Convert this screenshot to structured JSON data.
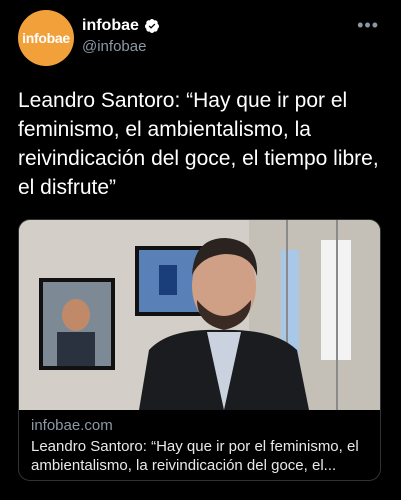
{
  "account": {
    "avatar_text": "infobae",
    "display_name": "infobae",
    "handle": "@infobae",
    "more_label": "•••"
  },
  "tweet": {
    "text": "Leandro Santoro: “Hay que ir por el feminismo, el ambientalismo, la reivindicación del goce, el tiempo libre, el disfrute”"
  },
  "card": {
    "domain": "infobae.com",
    "title": "Leandro Santoro: “Hay que ir por el feminismo, el ambientalismo, la reivindicación del goce, el..."
  },
  "colors": {
    "background": "#000000",
    "avatar": "#f2a13a",
    "verified": "#1d9bf0",
    "secondary_text": "#8b98a5"
  }
}
